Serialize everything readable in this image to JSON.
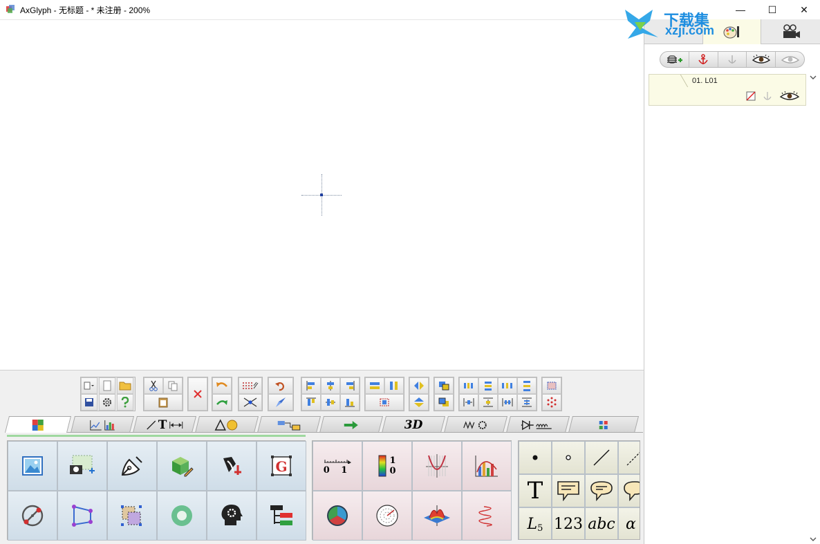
{
  "window": {
    "title": "AxGlyph - 无标题 - * 未注册 - 200%",
    "minimize": "—",
    "maximize": "☐",
    "close": "✕"
  },
  "watermark": {
    "line1": "下载集",
    "line2": "xzji.com"
  },
  "right_panel": {
    "layer": {
      "label": "01. L01"
    }
  },
  "tabs": [
    {
      "name": "palette-tab-basic"
    },
    {
      "name": "palette-tab-charts"
    },
    {
      "name": "palette-tab-lines-text",
      "label": "T"
    },
    {
      "name": "palette-tab-shapes"
    },
    {
      "name": "palette-tab-flowchart"
    },
    {
      "name": "palette-tab-arrows"
    },
    {
      "name": "palette-tab-3d",
      "label": "3D"
    },
    {
      "name": "palette-tab-mechanics"
    },
    {
      "name": "palette-tab-circuits"
    },
    {
      "name": "palette-tab-misc"
    }
  ],
  "palette2": {
    "axis_label": "0 1",
    "colorbar_top": "1",
    "colorbar_bottom": "0"
  },
  "palette3": {
    "text_tool": "T",
    "subscript_base": "L",
    "subscript_index": "5",
    "number": "123",
    "italic_text": "abc",
    "greek": "α"
  },
  "colors": {
    "accent_green": "#9fd89f",
    "panel_yellow": "#fbfbe6",
    "watermark_blue": "#1e8ee0"
  }
}
